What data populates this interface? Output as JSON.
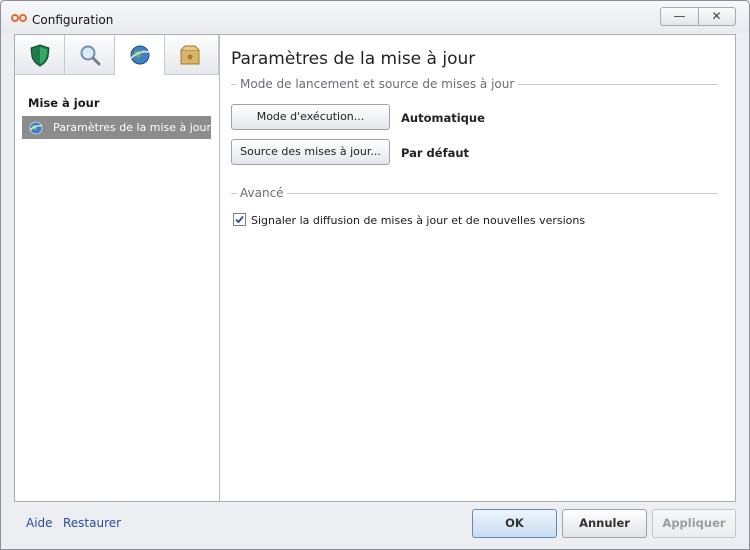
{
  "window": {
    "title": "Configuration",
    "minimize": "—",
    "close": "✕"
  },
  "sidebar": {
    "tabs": [
      {
        "icon": "shield-icon"
      },
      {
        "icon": "magnifier-icon"
      },
      {
        "icon": "globe-update-icon",
        "active": true
      },
      {
        "icon": "box-icon"
      }
    ],
    "section_title": "Mise à jour",
    "items": [
      {
        "label": "Paramètres de la mise à jour",
        "icon": "globe-update-icon",
        "selected": true
      }
    ]
  },
  "main": {
    "title": "Paramètres de la mise à jour",
    "group1": {
      "title": "Mode de lancement et source de mises à jour",
      "run_mode_button": "Mode d'exécution...",
      "run_mode_value": "Automatique",
      "source_button": "Source des mises à jour...",
      "source_value": "Par défaut"
    },
    "group2": {
      "title": "Avancé",
      "notify_checkbox_label": "Signaler la diffusion de mises à jour et de nouvelles versions",
      "notify_checked": true
    }
  },
  "footer": {
    "help_link": "Aide",
    "restore_link": "Restaurer",
    "ok_button": "OK",
    "cancel_button": "Annuler",
    "apply_button": "Appliquer"
  },
  "colors": {
    "accent": "#2a4ba0",
    "selection": "#8c8c8c",
    "app_icon": "#e8692a"
  }
}
